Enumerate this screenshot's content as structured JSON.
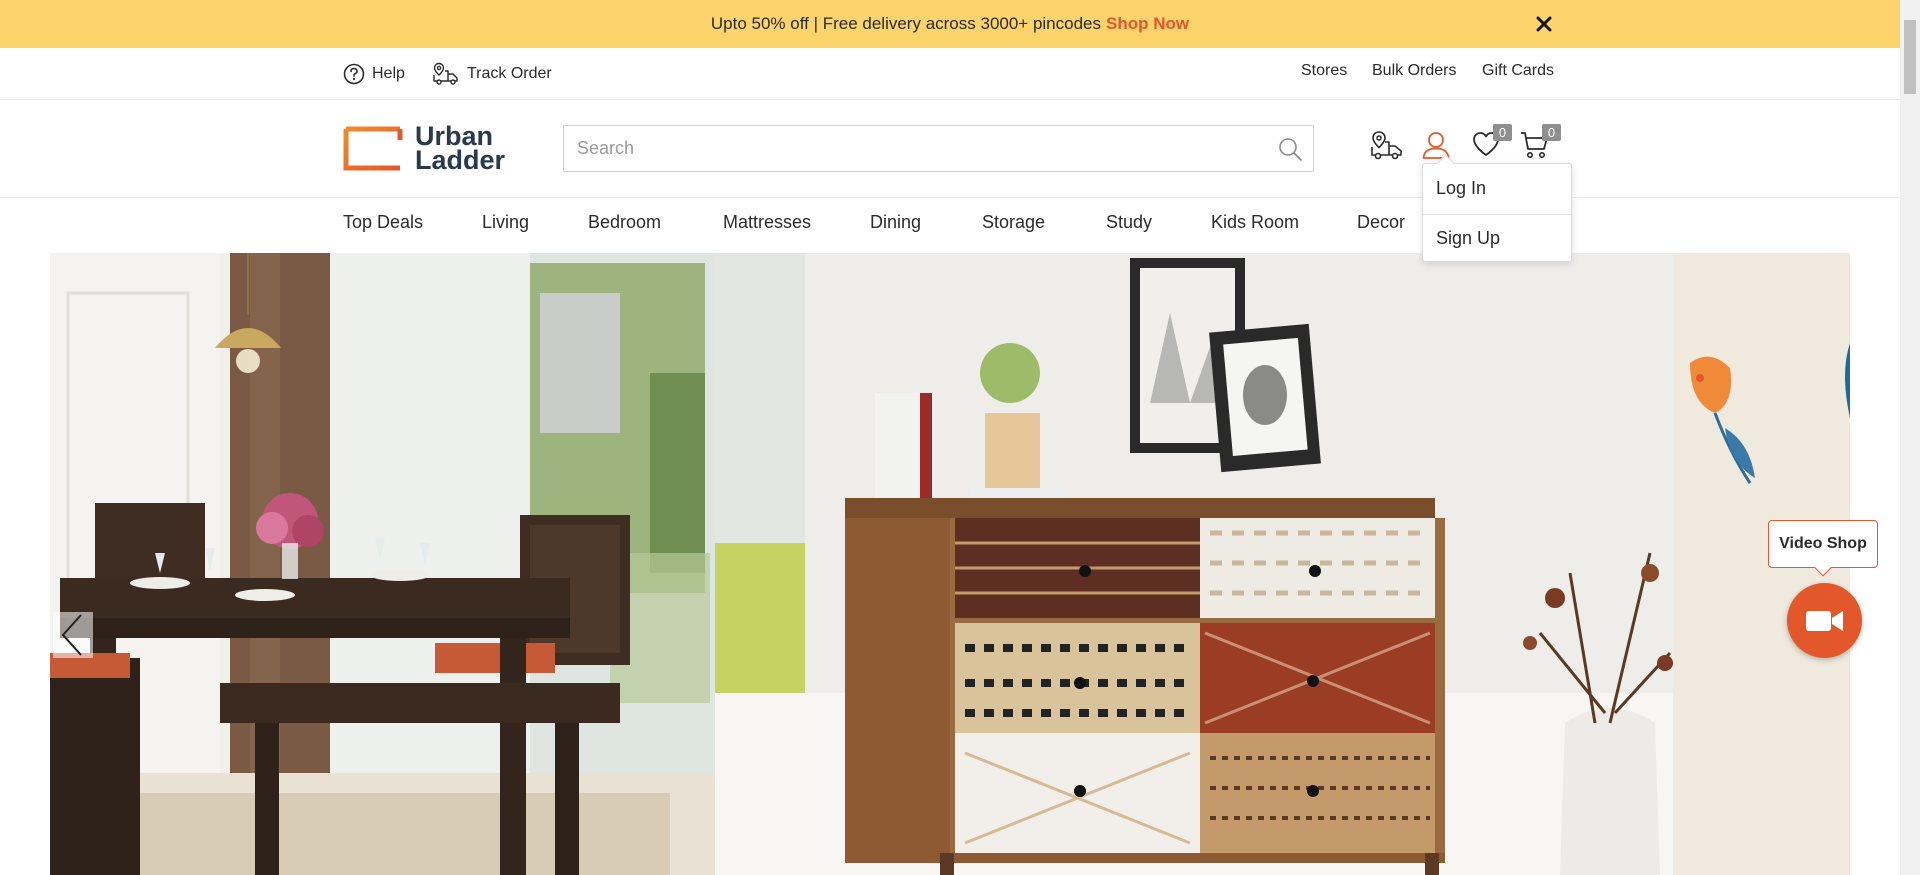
{
  "promo": {
    "text": "Upto 50% off | Free delivery across 3000+ pincodes",
    "link": "Shop Now"
  },
  "utility": {
    "help": "Help",
    "track_order": "Track Order",
    "stores": "Stores",
    "bulk_orders": "Bulk Orders",
    "gift_cards": "Gift Cards"
  },
  "header": {
    "logo_line1": "Urban",
    "logo_line2": "Ladder",
    "search_placeholder": "Search",
    "wishlist_count": "0",
    "cart_count": "0"
  },
  "nav": {
    "items": [
      "Top Deals",
      "Living",
      "Bedroom",
      "Mattresses",
      "Dining",
      "Storage",
      "Study",
      "Kids Room",
      "Decor"
    ]
  },
  "account_menu": {
    "login": "Log In",
    "signup": "Sign Up"
  },
  "video_shop": {
    "label": "Video Shop"
  },
  "colors": {
    "accent": "#e2582b",
    "promo_bg": "#fdd36c",
    "logo_text": "#2b3a4a"
  }
}
